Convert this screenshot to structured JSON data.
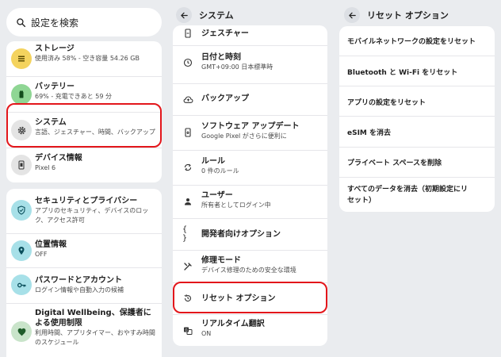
{
  "search": {
    "placeholder": "設定を検索"
  },
  "col1": {
    "group1": [
      {
        "title": "ストレージ",
        "sub": "使用済み 58% - 空き容量 54.26 GB",
        "icon": "storage-icon",
        "color": "#f4d35e"
      },
      {
        "title": "バッテリー",
        "sub": "69% - 充電できあと 59 分",
        "icon": "battery-icon",
        "color": "#8fd694"
      },
      {
        "title": "システム",
        "sub": "言語、ジェスチャー、時間、バックアップ",
        "icon": "gear-icon",
        "color": "#e0e0e0"
      },
      {
        "title": "デバイス情報",
        "sub": "Pixel 6",
        "icon": "phone-icon",
        "color": "#e0e0e0"
      }
    ],
    "group2": [
      {
        "title": "セキュリティとプライバシー",
        "sub": "アプリのセキュリティ、デバイスのロック、アクセス許可",
        "icon": "shield-icon",
        "color": "#a7e0e8"
      },
      {
        "title": "位置情報",
        "sub": "OFF",
        "icon": "location-icon",
        "color": "#a7e0e8"
      },
      {
        "title": "パスワードとアカウント",
        "sub": "ログイン情報や自動入力の候補",
        "icon": "key-icon",
        "color": "#a7e0e8"
      },
      {
        "title": "Digital Wellbeing、保護者による使用制限",
        "sub": "利用時間、アプリタイマー、おやすみ時間のスケジュール",
        "icon": "wellbeing-icon",
        "color": "#c9e4ca"
      }
    ]
  },
  "col2": {
    "back_label": "システム",
    "items": [
      {
        "title": "ジェスチャー",
        "sub": "",
        "icon": "gesture-phone-icon"
      },
      {
        "title": "日付と時刻",
        "sub": "GMT+09:00 日本標準時",
        "icon": "clock-icon"
      },
      {
        "title": "バックアップ",
        "sub": "",
        "icon": "cloud-backup-icon"
      },
      {
        "title": "ソフトウェア アップデート",
        "sub": "Google Pixel がさらに便利に",
        "icon": "system-update-icon"
      },
      {
        "title": "ルール",
        "sub": "0 件のルール",
        "icon": "rules-icon"
      },
      {
        "title": "ユーザー",
        "sub": "所有者としてログイン中",
        "icon": "person-icon"
      },
      {
        "title": "開発者向けオプション",
        "sub": "",
        "icon": "code-braces-icon"
      },
      {
        "title": "修理モード",
        "sub": "デバイス修理のための安全な環境",
        "icon": "repair-icon"
      },
      {
        "title": "リセット オプション",
        "sub": "",
        "icon": "reset-history-icon"
      },
      {
        "title": "リアルタイム翻訳",
        "sub": "ON",
        "icon": "translate-icon"
      }
    ]
  },
  "col3": {
    "back_label": "リセット オプション",
    "items": [
      "モバイルネットワークの設定をリセット",
      "Bluetooth と Wi-Fi をリセット",
      "アプリの設定をリセット",
      "eSIM を消去",
      "プライベート スペースを削除",
      "すべてのデータを消去（初期設定にリセット）"
    ]
  },
  "highlight_color": "#e3161b"
}
